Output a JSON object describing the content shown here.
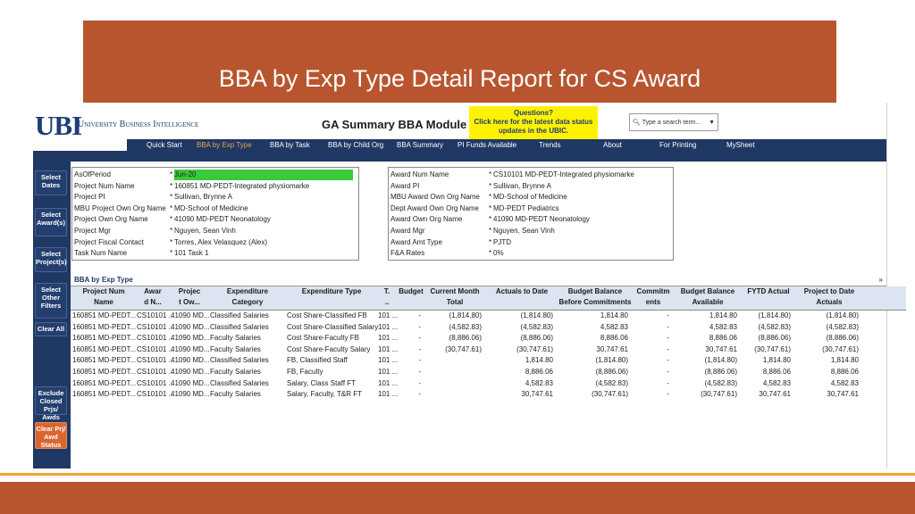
{
  "slide": {
    "title": "BBA by Exp Type Detail Report for CS Award"
  },
  "header": {
    "logo": "UBI",
    "logo_sub": "University Business Intelligence",
    "module_title": "GA Summary BBA Module",
    "questions": [
      "Questions?",
      "Click here for the latest data status",
      "updates in the UBIC."
    ],
    "search_placeholder": "Type a search term..."
  },
  "nav": [
    "Quick Start",
    "BBA by Exp Type",
    "BBA by Task",
    "BBA by Child Org",
    "BBA Summary",
    "PI Funds Available",
    "Trends",
    "About",
    "For Printing",
    "MySheet"
  ],
  "side_buttons": [
    [
      "Select",
      "Dates"
    ],
    [
      "Select",
      "Award(s)"
    ],
    [
      "Select",
      "Project(s)"
    ],
    [
      "Select",
      "Other",
      "Filters"
    ],
    [
      "Clear All"
    ],
    [
      "Exclude",
      "Closed Prjs/",
      "Awds"
    ],
    [
      "Clear Prj/",
      "Awd Status"
    ]
  ],
  "left_panel": [
    {
      "label": "AsOfPeriod",
      "value": "Jun-20"
    },
    {
      "label": "Project Num Name",
      "value": "160851 MD-PEDT-Integrated physiomarke"
    },
    {
      "label": "Project PI",
      "value": "Sullivan, Brynne A"
    },
    {
      "label": "MBU Project Own Org Name",
      "value": "MD-School of Medicine"
    },
    {
      "label": "Project Own Org Name",
      "value": "41090 MD-PEDT Neonatology"
    },
    {
      "label": "Project Mgr",
      "value": "Nguyen, Sean Vinh"
    },
    {
      "label": "Project Fiscal Contact",
      "value": "Torres, Alex Velasquez (Alex)"
    },
    {
      "label": "Task Num Name",
      "value": "101 Task 1"
    }
  ],
  "right_panel": [
    {
      "label": "Award Num Name",
      "value": "CS10101 MD-PEDT-Integrated physiomarke"
    },
    {
      "label": "Award PI",
      "value": "Sullivan, Brynne A"
    },
    {
      "label": "MBU Award Own Org Name",
      "value": "MD-School of Medicine"
    },
    {
      "label": "Dept Award Own Org Name",
      "value": "MD-PEDT Pediatrics"
    },
    {
      "label": "Award Own Org Name",
      "value": "41090 MD-PEDT Neonatology"
    },
    {
      "label": "Award Mgr",
      "value": "Nguyen, Sean Vinh"
    },
    {
      "label": "Award Amt Type",
      "value": "PJTD"
    },
    {
      "label": "F&A Rates",
      "value": "0%"
    }
  ],
  "grid": {
    "title": "BBA by Exp Type",
    "expand": "»",
    "columns": [
      [
        "Project Num",
        "Name"
      ],
      [
        "Awar",
        "d N..."
      ],
      [
        "Projec",
        "t Ow..."
      ],
      [
        "Expenditure",
        "Category"
      ],
      [
        "Expenditure Type"
      ],
      [
        "T.",
        ".."
      ],
      [
        "Budget"
      ],
      [
        "Current Month",
        "Total"
      ],
      [
        "Actuals to Date"
      ],
      [
        "Budget Balance",
        "Before Commitments"
      ],
      [
        "Commitm",
        "ents"
      ],
      [
        "Budget Balance",
        "Available"
      ],
      [
        "FYTD Actual"
      ],
      [
        "Project to Date",
        "Actuals"
      ]
    ],
    "rows": [
      [
        "160851 MD-PEDT...",
        "CS10101 ...",
        "41090 MD...",
        "Classified Salaries",
        "Cost Share-Classified FB",
        "101 ...",
        "-",
        "(1,814.80)",
        "(1,814.80)",
        "1,814.80",
        "-",
        "1,814.80",
        "(1,814.80)",
        "(1,814.80)"
      ],
      [
        "160851 MD-PEDT...",
        "CS10101 ...",
        "41090 MD...",
        "Classified Salaries",
        "Cost Share-Classified Salary",
        "101 ...",
        "-",
        "(4,582.83)",
        "(4,582.83)",
        "4,582.83",
        "-",
        "4,582.83",
        "(4,582.83)",
        "(4,582.83)"
      ],
      [
        "160851 MD-PEDT...",
        "CS10101 ...",
        "41090 MD...",
        "Faculty Salaries",
        "Cost Share-Faculty FB",
        "101 ...",
        "-",
        "(8,886.06)",
        "(8,886.06)",
        "8,886.06",
        "-",
        "8,886.06",
        "(8,886.06)",
        "(8,886.06)"
      ],
      [
        "160851 MD-PEDT...",
        "CS10101 ...",
        "41090 MD...",
        "Faculty Salaries",
        "Cost Share-Faculty Salary",
        "101 ...",
        "-",
        "(30,747.61)",
        "(30,747.61)",
        "30,747.61",
        "-",
        "30,747.61",
        "(30,747.61)",
        "(30,747.61)"
      ],
      [
        "160851 MD-PEDT...",
        "CS10101 ...",
        "41090 MD...",
        "Classified Salaries",
        "FB, Classified Staff",
        "101 ...",
        "-",
        "",
        "1,814.80",
        "(1,814.80)",
        "-",
        "(1,814.80)",
        "1,814.80",
        "1,814.80"
      ],
      [
        "160851 MD-PEDT...",
        "CS10101 ...",
        "41090 MD...",
        "Faculty Salaries",
        "FB, Faculty",
        "101 ...",
        "-",
        "",
        "8,886.06",
        "(8,886.06)",
        "-",
        "(8,886.06)",
        "8,886.06",
        "8,886.06"
      ],
      [
        "160851 MD-PEDT...",
        "CS10101 ...",
        "41090 MD...",
        "Classified Salaries",
        "Salary, Class Staff FT",
        "101 ...",
        "-",
        "",
        "4,582.83",
        "(4,582.83)",
        "-",
        "(4,582.83)",
        "4,582.83",
        "4,582.83"
      ],
      [
        "160851 MD-PEDT...",
        "CS10101 ...",
        "41090 MD...",
        "Faculty Salaries",
        "Salary, Faculty, T&R FT",
        "101 ...",
        "-",
        "",
        "30,747.61",
        "(30,747.61)",
        "-",
        "(30,747.61)",
        "30,747.61",
        "30,747.61"
      ]
    ]
  }
}
